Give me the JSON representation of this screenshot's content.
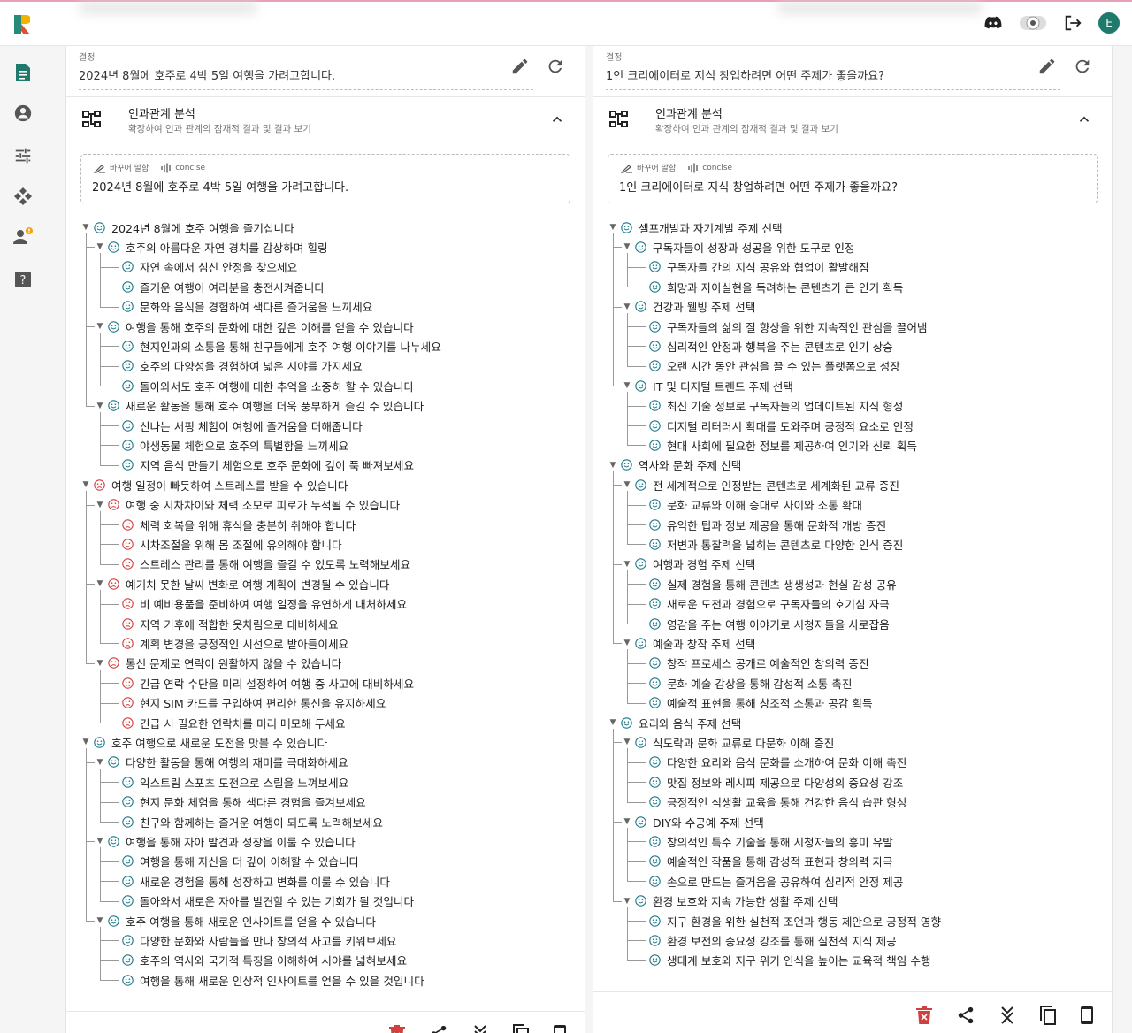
{
  "topbar": {
    "icons": [
      "discord-icon",
      "theme-toggle-icon",
      "logout-icon"
    ],
    "avatar_letter": "E"
  },
  "sidebar": {
    "items": [
      "document-icon",
      "account-icon",
      "tune-icon",
      "network-icon",
      "user-alert-icon",
      "help-icon"
    ]
  },
  "colors": {
    "accent": "#1e7a6a",
    "good": "#1e7a8a",
    "bad": "#d23f3f",
    "delete": "#d23f3f"
  },
  "panels": [
    {
      "decision_label": "결정",
      "decision": "2024년 8월에 호주로 4박 5일 여행을 가려고합니다.",
      "causal_title": "인과관계 분석",
      "causal_subtitle": "확장하여 인과 관계의 잠재적 결과 및 결과 보기",
      "rephrase_label": "바꾸어 말함",
      "concise_label": "concise",
      "rephrased": "2024년 8월에 호주로 4박 5일 여행을 가려고합니다.",
      "tree": [
        {
          "text": "2024년 8월에 호주 여행을 즐기십니다",
          "sentiment": "good",
          "children": [
            {
              "text": "호주의 아름다운 자연 경치를 감상하며 힐링",
              "sentiment": "good",
              "children": [
                {
                  "text": "자연 속에서 심신 안정을 찾으세요",
                  "sentiment": "good"
                },
                {
                  "text": "즐거운 여행이 여러분을 충전시켜줍니다",
                  "sentiment": "good"
                },
                {
                  "text": "문화와 음식을 경험하여 색다른 즐거움을 느끼세요",
                  "sentiment": "good"
                }
              ]
            },
            {
              "text": "여행을 통해 호주의 문화에 대한 깊은 이해를 얻을 수 있습니다",
              "sentiment": "good",
              "children": [
                {
                  "text": "현지인과의 소통을 통해 친구들에게 호주 여행 이야기를 나누세요",
                  "sentiment": "good"
                },
                {
                  "text": "호주의 다양성을 경험하여 넓은 시야를 가지세요",
                  "sentiment": "good"
                },
                {
                  "text": "돌아와서도 호주 여행에 대한 추억을 소중히 할 수 있습니다",
                  "sentiment": "good"
                }
              ]
            },
            {
              "text": "새로운 활동을 통해 호주 여행을 더욱 풍부하게 즐길 수 있습니다",
              "sentiment": "good",
              "children": [
                {
                  "text": "신나는 서핑 체험이 여행에 즐거움을 더해줍니다",
                  "sentiment": "good"
                },
                {
                  "text": "야생동물 체험으로 호주의 특별함을 느끼세요",
                  "sentiment": "good"
                },
                {
                  "text": "지역 음식 만들기 체험으로 호주 문화에 깊이 푹 빠져보세요",
                  "sentiment": "good"
                }
              ]
            }
          ]
        },
        {
          "text": "여행 일정이 빠듯하여 스트레스를 받을 수 있습니다",
          "sentiment": "bad",
          "children": [
            {
              "text": "여행 중 시차차이와 체력 소모로 피로가 누적될 수 있습니다",
              "sentiment": "bad",
              "children": [
                {
                  "text": "체력 회복을 위해 휴식을 충분히 취해야 합니다",
                  "sentiment": "bad"
                },
                {
                  "text": "시차조절을 위해 몸 조절에 유의해야 합니다",
                  "sentiment": "bad"
                },
                {
                  "text": "스트레스 관리를 통해 여행을 즐길 수 있도록 노력해보세요",
                  "sentiment": "bad"
                }
              ]
            },
            {
              "text": "예기치 못한 날씨 변화로 여행 계획이 변경될 수 있습니다",
              "sentiment": "bad",
              "children": [
                {
                  "text": "비 예비용품을 준비하여 여행 일정을 유연하게 대처하세요",
                  "sentiment": "bad"
                },
                {
                  "text": "지역 기후에 적합한 옷차림으로 대비하세요",
                  "sentiment": "bad"
                },
                {
                  "text": "계획 변경을 긍정적인 시선으로 받아들이세요",
                  "sentiment": "bad"
                }
              ]
            },
            {
              "text": "통신 문제로 연락이 원활하지 않을 수 있습니다",
              "sentiment": "bad",
              "children": [
                {
                  "text": "긴급 연락 수단을 미리 설정하여 여행 중 사고에 대비하세요",
                  "sentiment": "bad"
                },
                {
                  "text": "현지 SIM 카드를 구입하여 편리한 통신을 유지하세요",
                  "sentiment": "bad"
                },
                {
                  "text": "긴급 시 필요한 연락처를 미리 메모해 두세요",
                  "sentiment": "bad"
                }
              ]
            }
          ]
        },
        {
          "text": "호주 여행으로 새로운 도전을 맛볼 수 있습니다",
          "sentiment": "good",
          "children": [
            {
              "text": "다양한 활동을 통해 여행의 재미를 극대화하세요",
              "sentiment": "good",
              "children": [
                {
                  "text": "익스트림 스포츠 도전으로 스릴을 느껴보세요",
                  "sentiment": "good"
                },
                {
                  "text": "현지 문화 체험을 통해 색다른 경험을 즐겨보세요",
                  "sentiment": "good"
                },
                {
                  "text": "친구와 함께하는 즐거운 여행이 되도록 노력해보세요",
                  "sentiment": "good"
                }
              ]
            },
            {
              "text": "여행을 통해 자아 발견과 성장을 이룰 수 있습니다",
              "sentiment": "good",
              "children": [
                {
                  "text": "여행을 통해 자신을 더 깊이 이해할 수 있습니다",
                  "sentiment": "good"
                },
                {
                  "text": "새로운 경험을 통해 성장하고 변화를 이룰 수 있습니다",
                  "sentiment": "good"
                },
                {
                  "text": "돌아와서 새로운 자아를 발견할 수 있는 기회가 될 것입니다",
                  "sentiment": "good"
                }
              ]
            },
            {
              "text": "호주 여행을 통해 새로운 인사이트를 얻을 수 있습니다",
              "sentiment": "good",
              "children": [
                {
                  "text": "다양한 문화와 사람들을 만나 창의적 사고를 키워보세요",
                  "sentiment": "good"
                },
                {
                  "text": "호주의 역사와 국가적 특징을 이해하여 시야를 넓혀보세요",
                  "sentiment": "good"
                },
                {
                  "text": "여행을 통해 새로운 인상적 인사이트를 얻을 수 있을 것입니다",
                  "sentiment": "good"
                }
              ]
            }
          ]
        }
      ],
      "bottom_icons": [
        "delete-icon",
        "share-icon",
        "collapse-all-icon",
        "copy-icon",
        "mobile-icon"
      ]
    },
    {
      "decision_label": "결정",
      "decision": "1인 크리에이터로 지식 창업하려면 어떤 주제가 좋을까요?",
      "causal_title": "인과관계 분석",
      "causal_subtitle": "확장하여 인과 관계의 잠재적 결과 및 결과 보기",
      "rephrase_label": "바꾸어 말함",
      "concise_label": "concise",
      "rephrased": "1인 크리에이터로 지식 창업하려면 어떤 주제가 좋을까요?",
      "tree": [
        {
          "text": "셀프개발과 자기계발 주제 선택",
          "sentiment": "good",
          "children": [
            {
              "text": "구독자들이 성장과 성공을 위한 도구로 인정",
              "sentiment": "good",
              "children": [
                {
                  "text": "구독자들 간의 지식 공유와 협업이 활발해짐",
                  "sentiment": "good"
                },
                {
                  "text": "희망과 자아실현을 독려하는 콘텐츠가 큰 인기 획득",
                  "sentiment": "good"
                }
              ]
            },
            {
              "text": "건강과 웰빙 주제 선택",
              "sentiment": "good",
              "children": [
                {
                  "text": "구독자들의 삶의 질 향상을 위한 지속적인 관심을 끌어냄",
                  "sentiment": "good"
                },
                {
                  "text": "심리적인 안정과 행복을 주는 콘텐츠로 인기 상승",
                  "sentiment": "good"
                },
                {
                  "text": "오랜 시간 동안 관심을 끌 수 있는 플랫폼으로 성장",
                  "sentiment": "good"
                }
              ]
            },
            {
              "text": "IT 및 디지털 트렌드 주제 선택",
              "sentiment": "good",
              "children": [
                {
                  "text": "최신 기술 정보로 구독자들의 업데이트된 지식 형성",
                  "sentiment": "good"
                },
                {
                  "text": "디지털 리터러시 확대를 도와주며 긍정적 요소로 인정",
                  "sentiment": "good"
                },
                {
                  "text": "현대 사회에 필요한 정보를 제공하여 인기와 신뢰 획득",
                  "sentiment": "good"
                }
              ]
            }
          ]
        },
        {
          "text": "역사와 문화 주제 선택",
          "sentiment": "good",
          "children": [
            {
              "text": "전 세계적으로 인정받는 콘텐츠로 세계화된 교류 증진",
              "sentiment": "good",
              "children": [
                {
                  "text": "문화 교류와 이해 증대로 사이와 소통 확대",
                  "sentiment": "good"
                },
                {
                  "text": "유익한 팁과 정보 제공을 통해 문화적 개방 증진",
                  "sentiment": "good"
                },
                {
                  "text": "저변과 통찰력을 넓히는 콘텐츠로 다양한 인식 증진",
                  "sentiment": "good"
                }
              ]
            },
            {
              "text": "여행과 경험 주제 선택",
              "sentiment": "good",
              "children": [
                {
                  "text": "실제 경험을 통해 콘텐츠 생생성과 현실 감성 공유",
                  "sentiment": "good"
                },
                {
                  "text": "새로운 도전과 경험으로 구독자들의 호기심 자극",
                  "sentiment": "good"
                },
                {
                  "text": "영감을 주는 여행 이야기로 시청자들을 사로잡음",
                  "sentiment": "good"
                }
              ]
            },
            {
              "text": "예술과 창작 주제 선택",
              "sentiment": "good",
              "children": [
                {
                  "text": "창작 프로세스 공개로 예술적인 창의력 증진",
                  "sentiment": "good"
                },
                {
                  "text": "문화 예술 감상을 통해 감성적 소통 촉진",
                  "sentiment": "good"
                },
                {
                  "text": "예술적 표현을 통해 창조적 소통과 공감 획득",
                  "sentiment": "good"
                }
              ]
            }
          ]
        },
        {
          "text": "요리와 음식 주제 선택",
          "sentiment": "good",
          "children": [
            {
              "text": "식도락과 문화 교류로 다문화 이해 증진",
              "sentiment": "good",
              "children": [
                {
                  "text": "다양한 요리와 음식 문화를 소개하여 문화 이해 촉진",
                  "sentiment": "good"
                },
                {
                  "text": "맛집 정보와 레시피 제공으로 다양성의 중요성 강조",
                  "sentiment": "good"
                },
                {
                  "text": "긍정적인 식생활 교육을 통해 건강한 음식 습관 형성",
                  "sentiment": "good"
                }
              ]
            },
            {
              "text": "DIY와 수공예 주제 선택",
              "sentiment": "good",
              "children": [
                {
                  "text": "창의적인 특수 기술을 통해 시청자들의 흥미 유발",
                  "sentiment": "good"
                },
                {
                  "text": "예술적인 작품을 통해 감성적 표현과 창의력 자극",
                  "sentiment": "good"
                },
                {
                  "text": "손으로 만드는 즐거움을 공유하여 심리적 안정 제공",
                  "sentiment": "good"
                }
              ]
            },
            {
              "text": "환경 보호와 지속 가능한 생활 주제 선택",
              "sentiment": "good",
              "children": [
                {
                  "text": "지구 환경을 위한 실천적 조언과 행동 제안으로 긍정적 영향",
                  "sentiment": "good"
                },
                {
                  "text": "환경 보전의 중요성 강조를 통해 실천적 지식 제공",
                  "sentiment": "good"
                },
                {
                  "text": "생태계 보호와 지구 위기 인식을 높이는 교육적 책임 수행",
                  "sentiment": "good"
                }
              ]
            }
          ]
        }
      ],
      "bottom_icons": [
        "delete-icon",
        "share-icon",
        "collapse-all-icon",
        "copy-icon",
        "mobile-icon"
      ]
    }
  ]
}
